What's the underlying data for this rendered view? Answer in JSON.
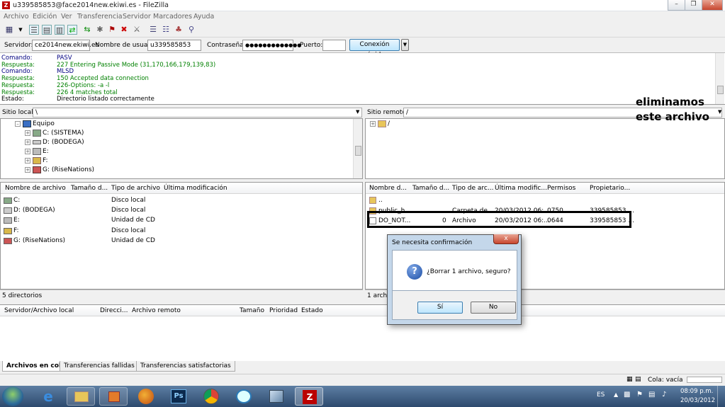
{
  "window": {
    "title": "u339585853@face2014new.ekiwi.es - FileZilla",
    "app_icon": "Z"
  },
  "menu": [
    "Archivo",
    "Edición",
    "Ver",
    "Transferencia",
    "Servidor",
    "Marcadores",
    "Ayuda"
  ],
  "quickconnect": {
    "server_label": "Servidor:",
    "server_value": "ce2014new.ekiwi.es",
    "user_label": "Nombre de usuario:",
    "user_value": "u339585853",
    "password_label": "Contraseña:",
    "password_value": "●●●●●●●●●●●●●",
    "port_label": "Puerto:",
    "port_value": "",
    "connect_label": "Conexión rápida"
  },
  "log": [
    {
      "key": "Comando:",
      "text": "PASV",
      "color": "#000080"
    },
    {
      "key": "Respuesta:",
      "text": "227 Entering Passive Mode (31,170,166,179,139,83)",
      "color": "#008000"
    },
    {
      "key": "Comando:",
      "text": "MLSD",
      "color": "#000080"
    },
    {
      "key": "Respuesta:",
      "text": "150 Accepted data connection",
      "color": "#008000"
    },
    {
      "key": "Respuesta:",
      "text": "226-Options: -a -l",
      "color": "#008000"
    },
    {
      "key": "Respuesta:",
      "text": "226 4 matches total",
      "color": "#008000"
    },
    {
      "key": "Estado:",
      "text": "Directorio listado correctamente",
      "color": "#000000"
    }
  ],
  "local": {
    "site_label": "Sitio local:",
    "site_value": "\\",
    "tree": [
      {
        "label": "Equipo"
      },
      {
        "label": "C: (SISTEMA)"
      },
      {
        "label": "D: (BODEGA)"
      },
      {
        "label": "E:"
      },
      {
        "label": "F:"
      },
      {
        "label": "G: (RiseNations)"
      }
    ],
    "columns": [
      "Nombre de archivo",
      "Tamaño d...",
      "Tipo de archivo",
      "Última modificación"
    ],
    "files": [
      {
        "name": "C:",
        "type": "Disco local"
      },
      {
        "name": "D: (BODEGA)",
        "type": "Disco local"
      },
      {
        "name": "E:",
        "type": "Unidad de CD"
      },
      {
        "name": "F:",
        "type": "Disco local"
      },
      {
        "name": "G: (RiseNations)",
        "type": "Unidad de CD"
      }
    ],
    "status": "5 directorios"
  },
  "remote": {
    "site_label": "Sitio remoto:",
    "site_value": "/",
    "tree_root": "/",
    "columns": [
      "Nombre d...",
      "Tamaño d...",
      "Tipo de arc...",
      "Última modific...",
      "Permisos",
      "Propietario..."
    ],
    "files": [
      {
        "name": "..",
        "size": "",
        "type": "",
        "modified": "",
        "perms": "",
        "owner": ""
      },
      {
        "name": "public_h...",
        "size": "",
        "type": "Carpeta de...",
        "modified": "20/03/2012 06:...",
        "perms": "0750",
        "owner": "339585853 ..."
      },
      {
        "name": "DO_NOT...",
        "size": "0",
        "type": "Archivo",
        "modified": "20/03/2012 06:...",
        "perms": "0644",
        "owner": "339585853 ..."
      }
    ],
    "status": "1 archi"
  },
  "queue": {
    "columns": [
      "Servidor/Archivo local",
      "Direcci...",
      "Archivo remoto",
      "Tamaño",
      "Prioridad",
      "Estado"
    ],
    "tabs": [
      "Archivos en cola",
      "Transferencias fallidas",
      "Transferencias satisfactorias"
    ],
    "status": "Cola: vacía"
  },
  "dialog": {
    "title": "Se necesita confirmación",
    "message": "¿Borrar 1 archivo, seguro?",
    "yes_label": "Sí",
    "no_label": "No",
    "close_glyph": "x"
  },
  "annotation": {
    "line1": "eliminamos",
    "line2": "este archivo"
  },
  "taskbar": {
    "lang": "ES",
    "time": "08:09 p.m.",
    "date": "20/03/2012",
    "ps_label": "Ps"
  }
}
